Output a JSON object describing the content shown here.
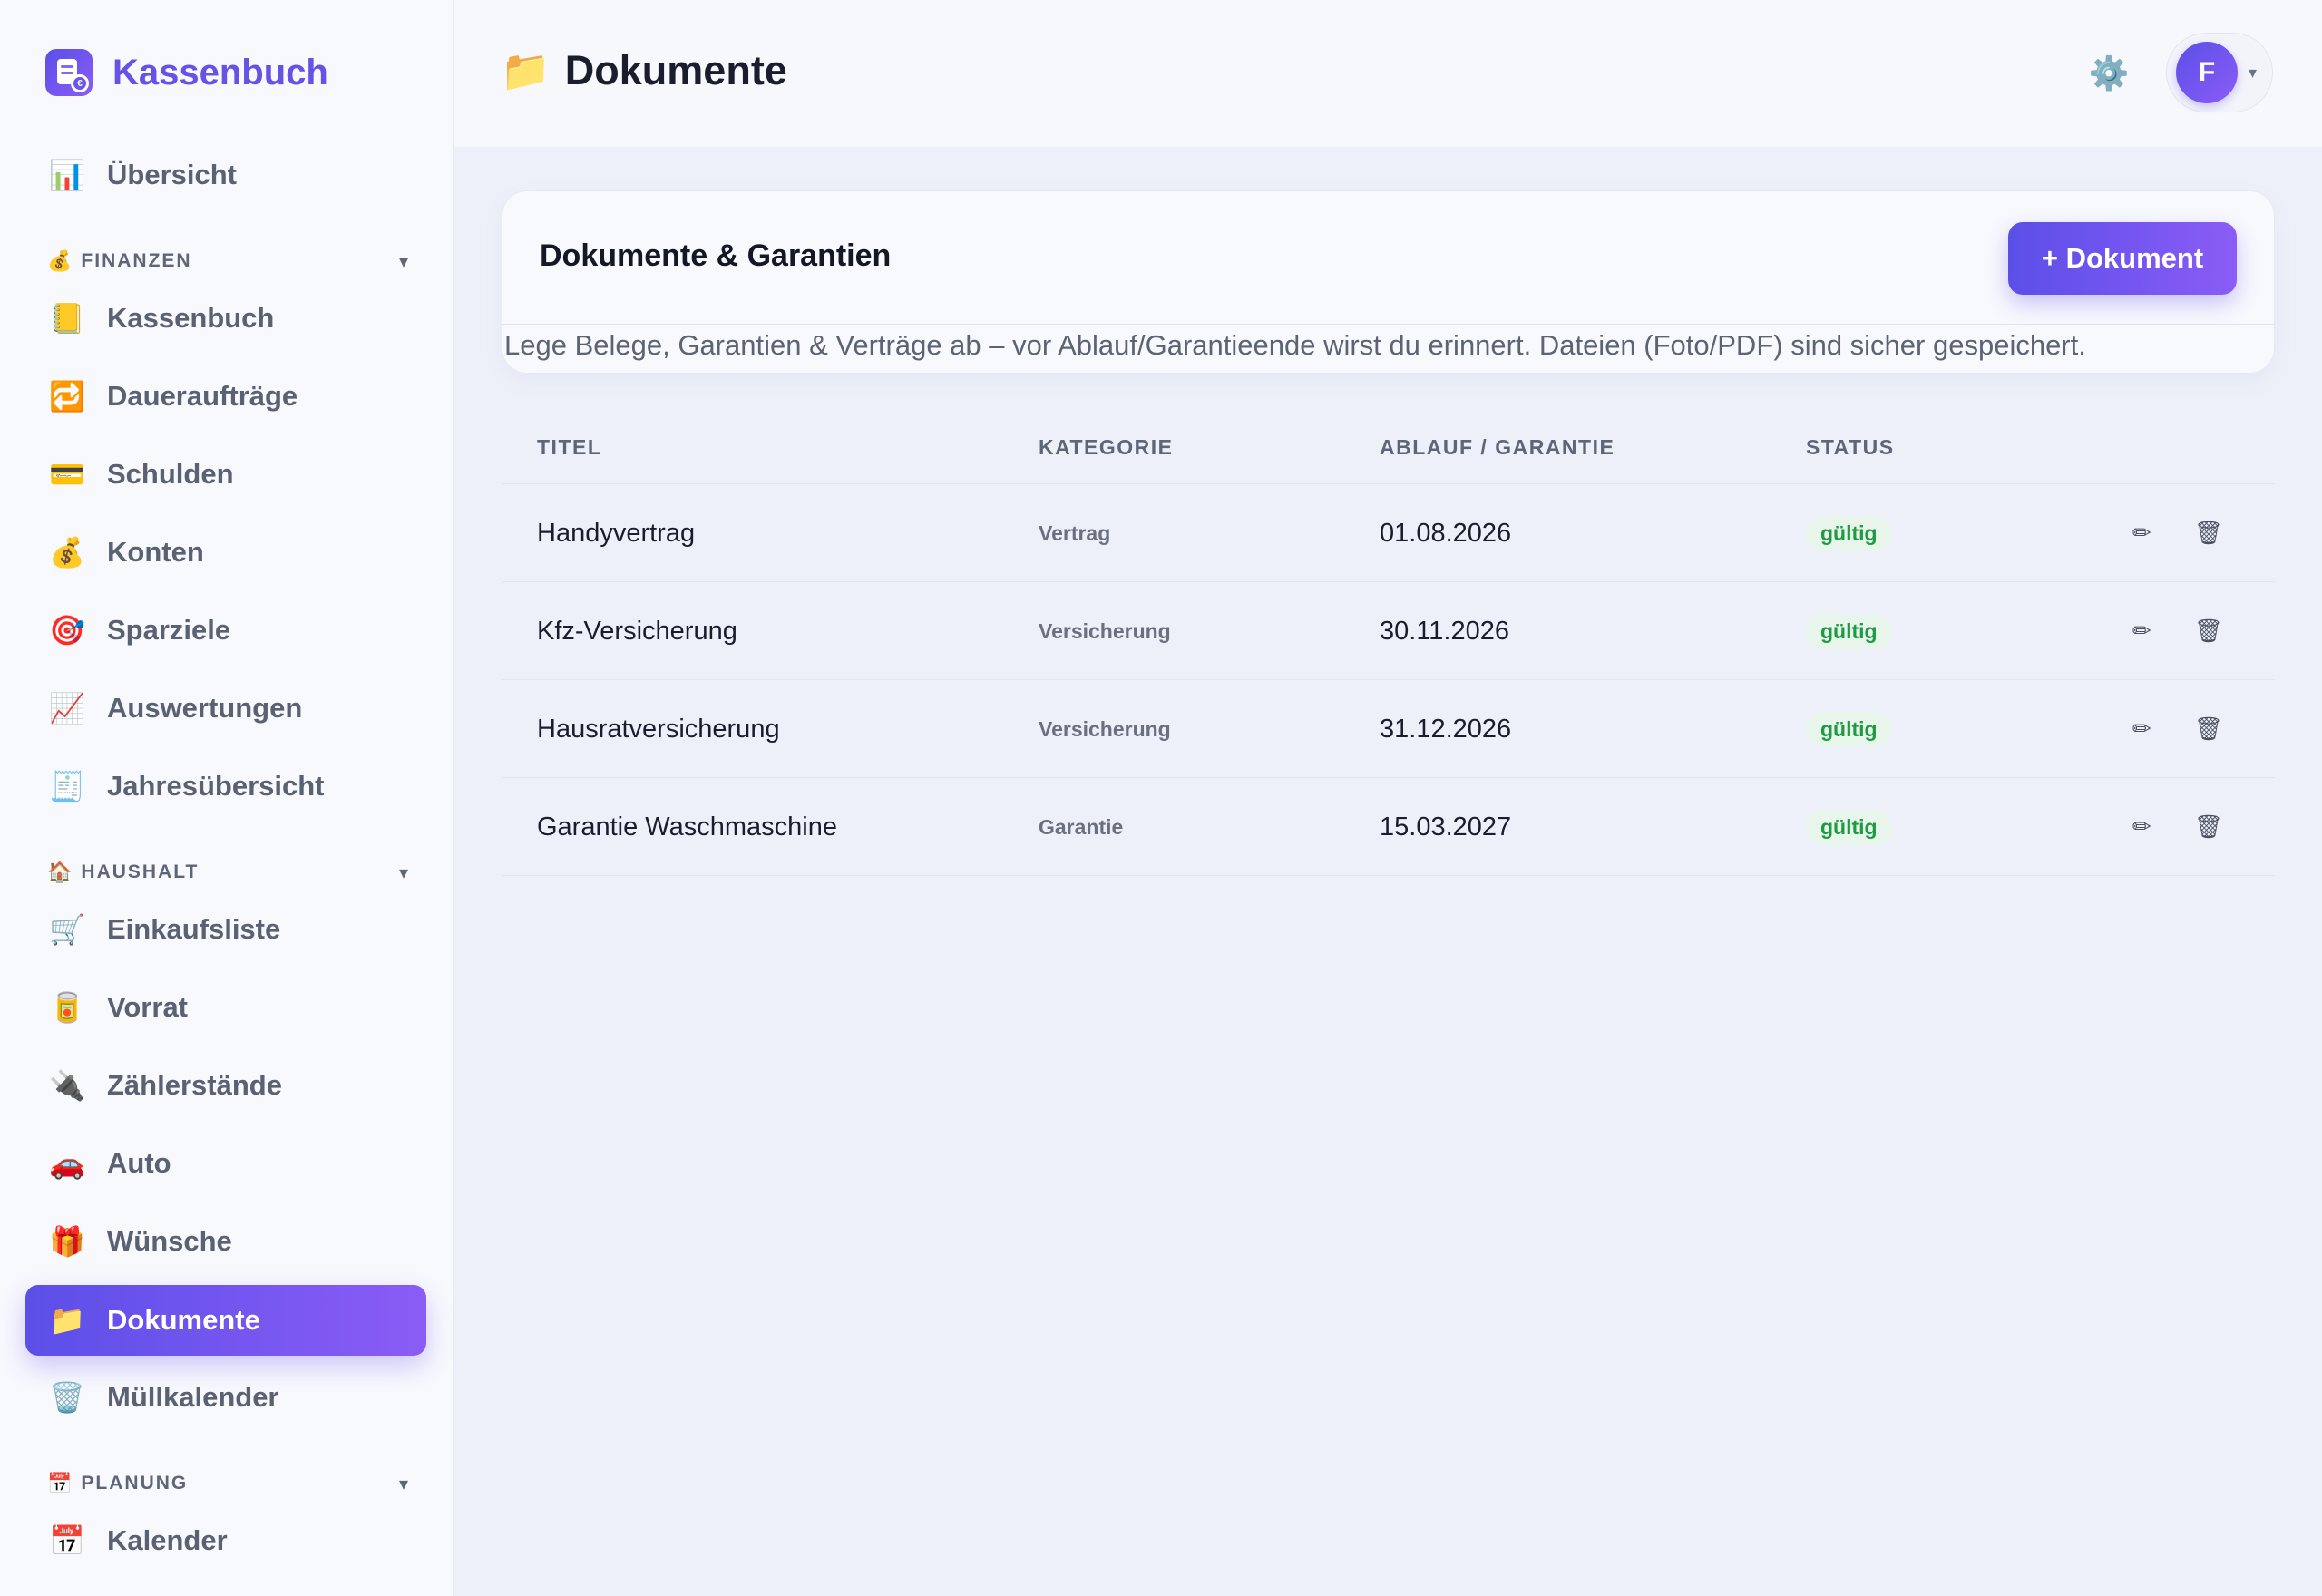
{
  "app": {
    "name": "Kassenbuch"
  },
  "sidebar": {
    "overview": {
      "label": "Übersicht",
      "icon": "📊"
    },
    "sections": [
      {
        "title": "FINANZEN",
        "icon": "💰",
        "items": [
          {
            "label": "Kassenbuch",
            "icon": "📒"
          },
          {
            "label": "Daueraufträge",
            "icon": "🔁"
          },
          {
            "label": "Schulden",
            "icon": "💳"
          },
          {
            "label": "Konten",
            "icon": "💰"
          },
          {
            "label": "Sparziele",
            "icon": "🎯"
          },
          {
            "label": "Auswertungen",
            "icon": "📈"
          },
          {
            "label": "Jahresübersicht",
            "icon": "🧾"
          }
        ]
      },
      {
        "title": "HAUSHALT",
        "icon": "🏠",
        "items": [
          {
            "label": "Einkaufsliste",
            "icon": "🛒"
          },
          {
            "label": "Vorrat",
            "icon": "🥫"
          },
          {
            "label": "Zählerstände",
            "icon": "🔌"
          },
          {
            "label": "Auto",
            "icon": "🚗"
          },
          {
            "label": "Wünsche",
            "icon": "🎁"
          },
          {
            "label": "Dokumente",
            "icon": "📁",
            "active": true
          },
          {
            "label": "Müllkalender",
            "icon": "🗑️"
          }
        ]
      },
      {
        "title": "PLANUNG",
        "icon": "📅",
        "items": [
          {
            "label": "Kalender",
            "icon": "📅"
          }
        ]
      }
    ],
    "chevron": "▾"
  },
  "header": {
    "title": "Dokumente",
    "title_icon": "📁",
    "settings_icon": "⚙️",
    "user_initial": "F",
    "user_chevron": "▾"
  },
  "card": {
    "title": "Dokumente & Garantien",
    "add_button": "+ Dokument",
    "description": "Lege Belege, Garantien & Verträge ab – vor Ablauf/Garantieende wirst du erinnert. Dateien (Foto/PDF) sind sicher gespeichert."
  },
  "table": {
    "columns": {
      "title": "TITEL",
      "category": "KATEGORIE",
      "expiry": "ABLAUF / GARANTIE",
      "status": "STATUS"
    },
    "rows": [
      {
        "title": "Handyvertrag",
        "category": "Vertrag",
        "expiry": "01.08.2026",
        "status": "gültig"
      },
      {
        "title": "Kfz-Versicherung",
        "category": "Versicherung",
        "expiry": "30.11.2026",
        "status": "gültig"
      },
      {
        "title": "Hausratversicherung",
        "category": "Versicherung",
        "expiry": "31.12.2026",
        "status": "gültig"
      },
      {
        "title": "Garantie Waschmaschine",
        "category": "Garantie",
        "expiry": "15.03.2027",
        "status": "gültig"
      }
    ],
    "edit_icon": "✏",
    "delete_icon": "🗑"
  }
}
